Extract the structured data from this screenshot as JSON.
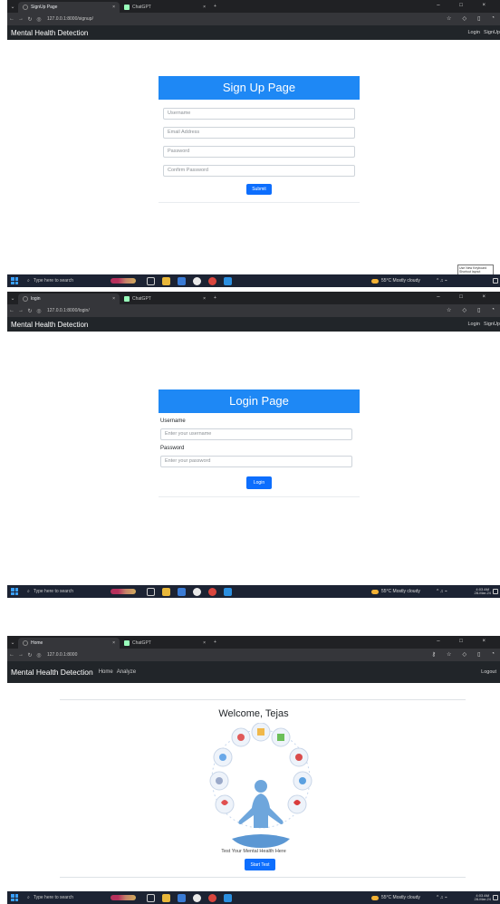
{
  "browser": {
    "chatgpt_tab": "ChatGPT",
    "new_tab": "+",
    "window_controls": "– □ ×"
  },
  "taskbar": {
    "search_placeholder": "Type here to search",
    "weather": "55°C  Mostly cloudy",
    "clock_time": "4:03 AM",
    "clock_date": "28-Mar-24",
    "tooltip": "Use New Keyboard Shortcut layout"
  },
  "app": {
    "brand": "Mental Health Detection"
  },
  "signup": {
    "tab_title": "SignUp Page",
    "url": "127.0.0.1:8000/signup/",
    "nav_right": [
      "Login",
      "SignUp"
    ],
    "heading": "Sign Up Page",
    "placeholders": {
      "username": "Username",
      "email": "Email Address",
      "password": "Password",
      "confirm": "Confirm Password"
    },
    "submit": "Submit"
  },
  "login": {
    "tab_title": "login",
    "url": "127.0.0.1:8000/login/",
    "nav_right": [
      "Login",
      "SignUp"
    ],
    "heading": "Login Page",
    "username_label": "Username",
    "username_placeholder": "Enter your username",
    "password_label": "Password",
    "password_placeholder": "Enter your password",
    "submit": "Login"
  },
  "home": {
    "tab_title": "Home",
    "url": "127.0.0.1:8000",
    "nav_links": [
      "Home",
      "Analyze"
    ],
    "logout": "Logout",
    "welcome": "Welcome, Tejas",
    "tagline": "Test Your Mental Health Here",
    "start": "Start Test"
  },
  "colors": {
    "header_blue": "#1e88f5",
    "button_blue": "#0d6efd",
    "navbar_dark": "#212529"
  }
}
